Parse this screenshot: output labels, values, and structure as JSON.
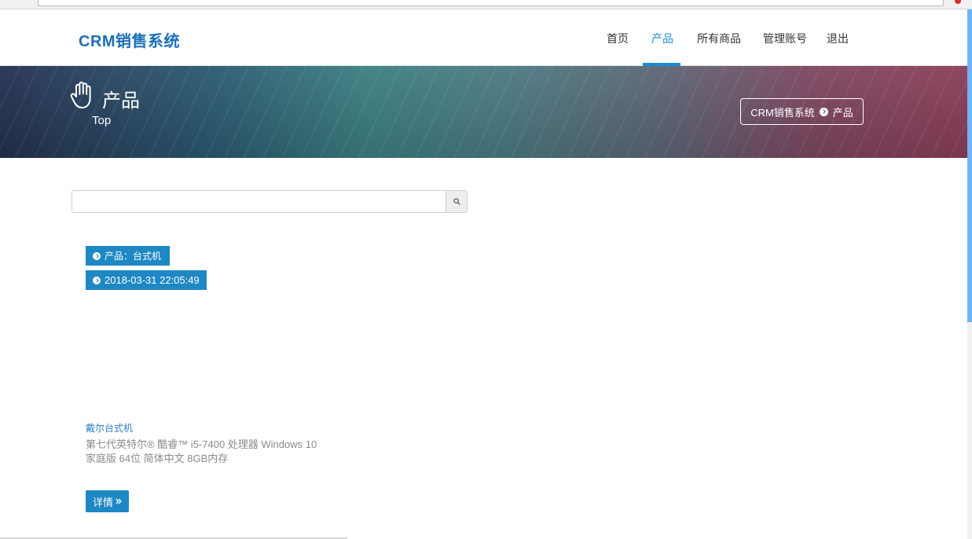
{
  "header": {
    "brand": "CRM销售系统",
    "nav": [
      {
        "label": "首页",
        "active": false
      },
      {
        "label": "产品",
        "active": true
      },
      {
        "label": "所有商品",
        "active": false
      },
      {
        "label": "管理账号",
        "active": false
      },
      {
        "label": "退出",
        "active": false
      }
    ]
  },
  "banner": {
    "icon": "hand-icon",
    "title": "产品",
    "subtitle": "Top",
    "breadcrumb": {
      "home": "CRM销售系统",
      "separator_icon": "circle-arrow-right-icon",
      "current": "产品"
    }
  },
  "search": {
    "value": "",
    "placeholder": "",
    "icon": "search-icon"
  },
  "product": {
    "category_tag": "产品：台式机",
    "date_tag": "2018-03-31 22:05:49",
    "tag_icon": "circle-arrow-right-icon",
    "name": "戴尔台式机",
    "description": "第七代英特尔® 酷睿™ i5-7400 处理器 Windows 10 家庭版 64位 简体中文 8GB内存",
    "detail_button": "详情",
    "detail_icon": "double-chevron-right-icon"
  },
  "colors": {
    "brand": "#1a6fb8",
    "accent": "#1d8ad6",
    "tag": "#1e88c4",
    "scrollbar_thumb": "#6fb3f5"
  }
}
